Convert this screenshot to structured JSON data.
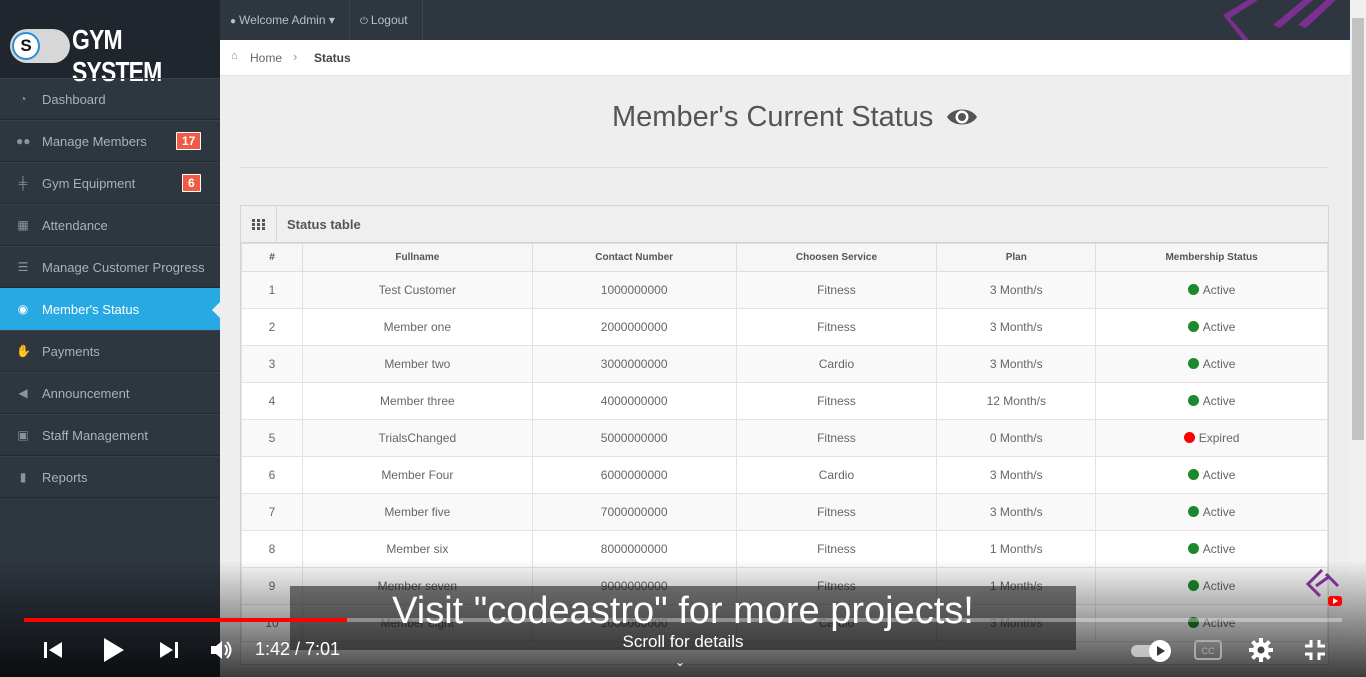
{
  "app": {
    "logo_letter": "S",
    "logo_title": "GYM SYSTEM"
  },
  "topbar": {
    "welcome": "Welcome Admin",
    "logout": "Logout"
  },
  "sidebar": {
    "items": [
      {
        "label": "Dashboard",
        "icon": "dashboard-icon"
      },
      {
        "label": "Manage Members",
        "icon": "users-icon",
        "badge": "17"
      },
      {
        "label": "Gym Equipment",
        "icon": "dumbbell-icon",
        "badge": "6"
      },
      {
        "label": "Attendance",
        "icon": "calendar-icon"
      },
      {
        "label": "Manage Customer Progress",
        "icon": "list-icon"
      },
      {
        "label": "Member's Status",
        "icon": "eye-icon",
        "active": true
      },
      {
        "label": "Payments",
        "icon": "hand-money-icon"
      },
      {
        "label": "Announcement",
        "icon": "bullhorn-icon"
      },
      {
        "label": "Staff Management",
        "icon": "briefcase-icon"
      },
      {
        "label": "Reports",
        "icon": "file-icon"
      }
    ]
  },
  "breadcrumb": {
    "home": "Home",
    "current": "Status"
  },
  "page": {
    "title": "Member's Current Status"
  },
  "table": {
    "title": "Status table",
    "columns": [
      "#",
      "Fullname",
      "Contact Number",
      "Choosen Service",
      "Plan",
      "Membership Status"
    ],
    "rows": [
      [
        "1",
        "Test Customer",
        "1000000000",
        "Fitness",
        "3 Month/s",
        "Active"
      ],
      [
        "2",
        "Member one",
        "2000000000",
        "Fitness",
        "3 Month/s",
        "Active"
      ],
      [
        "3",
        "Member two",
        "3000000000",
        "Cardio",
        "3 Month/s",
        "Active"
      ],
      [
        "4",
        "Member three",
        "4000000000",
        "Fitness",
        "12 Month/s",
        "Active"
      ],
      [
        "5",
        "TrialsChanged",
        "5000000000",
        "Fitness",
        "0 Month/s",
        "Expired"
      ],
      [
        "6",
        "Member Four",
        "6000000000",
        "Cardio",
        "3 Month/s",
        "Active"
      ],
      [
        "7",
        "Member five",
        "7000000000",
        "Fitness",
        "3 Month/s",
        "Active"
      ],
      [
        "8",
        "Member six",
        "8000000000",
        "Fitness",
        "1 Month/s",
        "Active"
      ],
      [
        "9",
        "Member seven",
        "9000000000",
        "Fitness",
        "1 Month/s",
        "Active"
      ],
      [
        "10",
        "Member eight",
        "1000000000",
        "Cardio",
        "3 Month/s",
        "Active"
      ]
    ],
    "status_colors": {
      "Active": "#1a8a2c",
      "Expired": "#ff0000"
    }
  },
  "video": {
    "caption": "Visit \"codeastro\" for more projects!",
    "time": "1:42 / 7:01",
    "scroll_hint": "Scroll for details",
    "progress": 0.245
  },
  "colors": {
    "sidebar_bg": "#2e363f",
    "accent": "#27a9e3",
    "badge": "#f15a44",
    "brand_purple": "#7b2f8e"
  }
}
